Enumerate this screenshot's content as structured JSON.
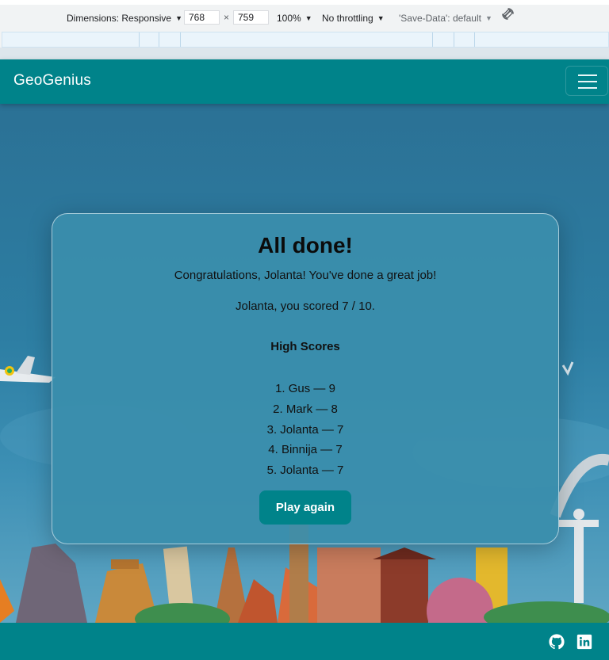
{
  "devtools": {
    "dimensions_label": "Dimensions: Responsive",
    "width_value": "768",
    "times": "×",
    "height_value": "759",
    "zoom": "100%",
    "throttling": "No throttling",
    "save_data": "'Save-Data': default",
    "rotate_icon": "rotate-icon"
  },
  "navbar": {
    "brand": "GeoGenius",
    "toggler_icon": "hamburger-menu-icon"
  },
  "result": {
    "title": "All done!",
    "congrats": "Congratulations, Jolanta! You've done a great job!",
    "score": "Jolanta, you scored 7 / 10.",
    "high_scores_title": "High Scores",
    "high_scores": [
      "1. Gus — 9",
      "2. Mark — 8",
      "3. Jolanta — 7",
      "4. Binnija — 7",
      "5. Jolanta — 7"
    ],
    "play_again": "Play again"
  },
  "footer": {
    "icons": [
      "github-icon",
      "linkedin-icon"
    ]
  },
  "colors": {
    "brand_teal": "#00838a",
    "card_bg": "#3a8eac",
    "sky_top": "#2b7195"
  }
}
